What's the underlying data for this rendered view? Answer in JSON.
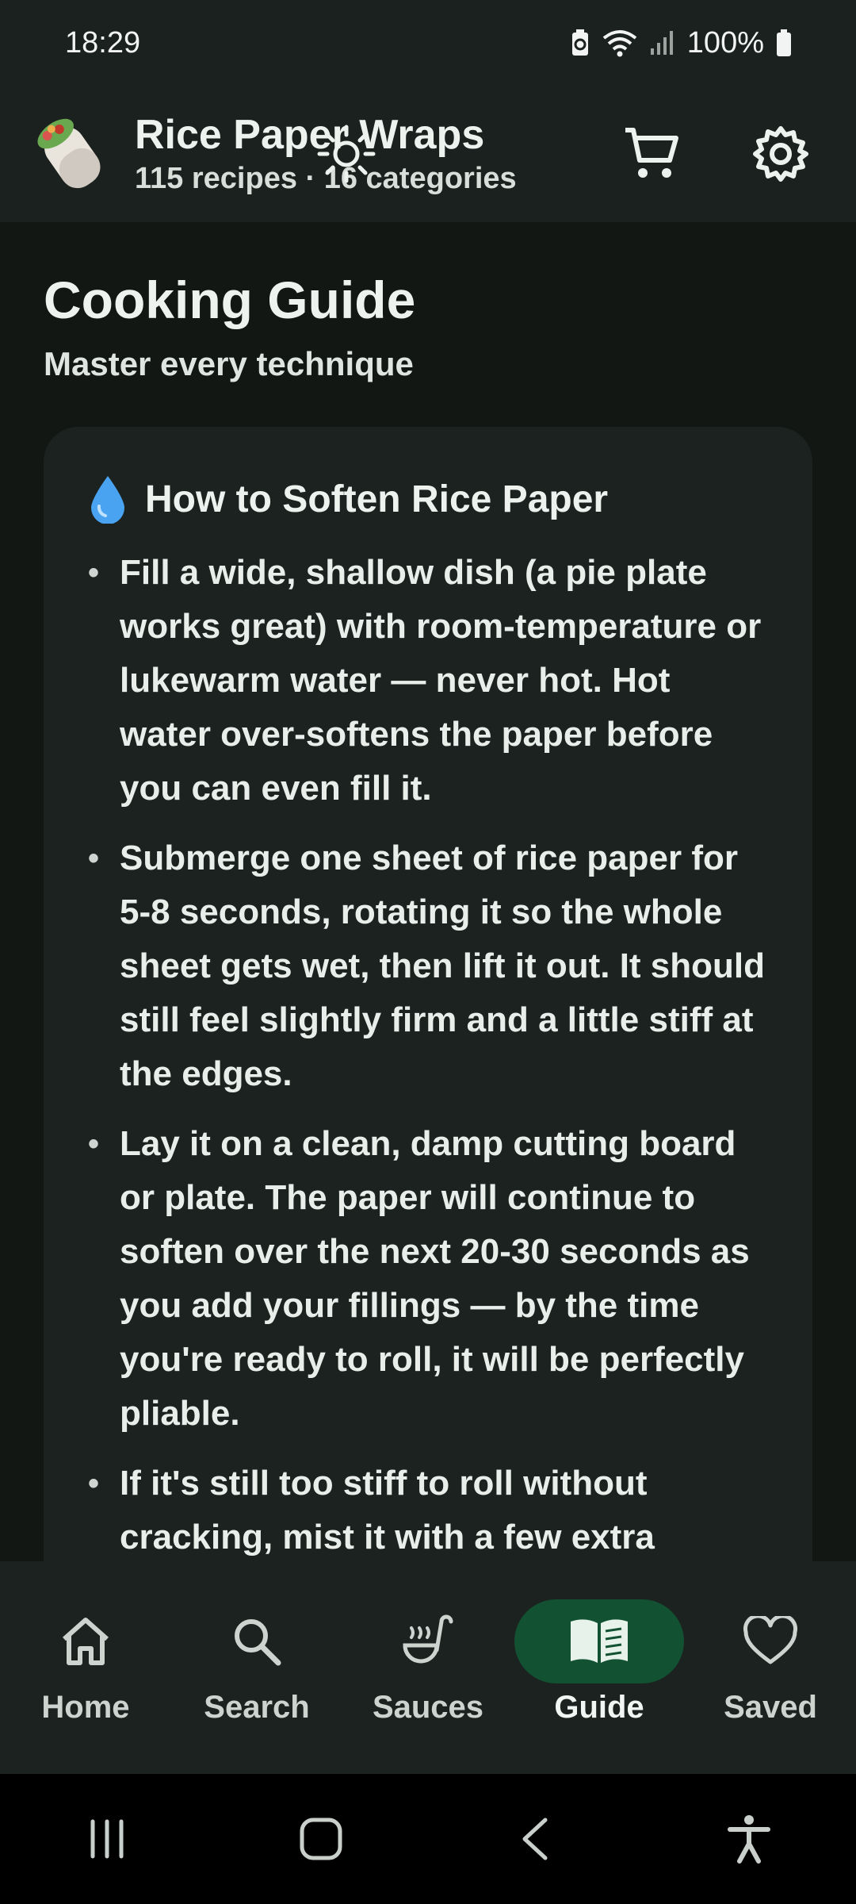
{
  "status": {
    "time": "18:29",
    "battery": "100%"
  },
  "app": {
    "name": "Rice Paper Wraps",
    "summary": "115 recipes · 16 categories",
    "actions": {
      "theme_icon": "sun-icon",
      "cart_icon": "cart-icon",
      "settings_icon": "gear-icon"
    }
  },
  "page": {
    "title": "Cooking Guide",
    "subtitle": "Master every technique"
  },
  "card": {
    "icon": "water-drop-icon",
    "title": "How to Soften Rice Paper",
    "tips": [
      "Fill a wide, shallow dish (a pie plate works great) with room-temperature or lukewarm water — never hot. Hot water over-softens the paper before you can even fill it.",
      "Submerge one sheet of rice paper for 5-8 seconds, rotating it so the whole sheet gets wet, then lift it out. It should still feel slightly firm and a little stiff at the edges.",
      "Lay it on a clean, damp cutting board or plate. The paper will continue to soften over the next 20-30 seconds as you add your fillings — by the time you're ready to roll, it will be perfectly pliable.",
      "If it's still too stiff to roll without cracking, mist it with a few extra"
    ]
  },
  "nav": {
    "items": [
      {
        "label": "Home",
        "icon": "home-icon"
      },
      {
        "label": "Search",
        "icon": "search-icon"
      },
      {
        "label": "Sauces",
        "icon": "ladle-icon"
      },
      {
        "label": "Guide",
        "icon": "book-icon",
        "active": true
      },
      {
        "label": "Saved",
        "icon": "heart-icon"
      }
    ]
  },
  "colors": {
    "background": "#121714",
    "surface": "#1c2220",
    "accent": "#125132"
  }
}
